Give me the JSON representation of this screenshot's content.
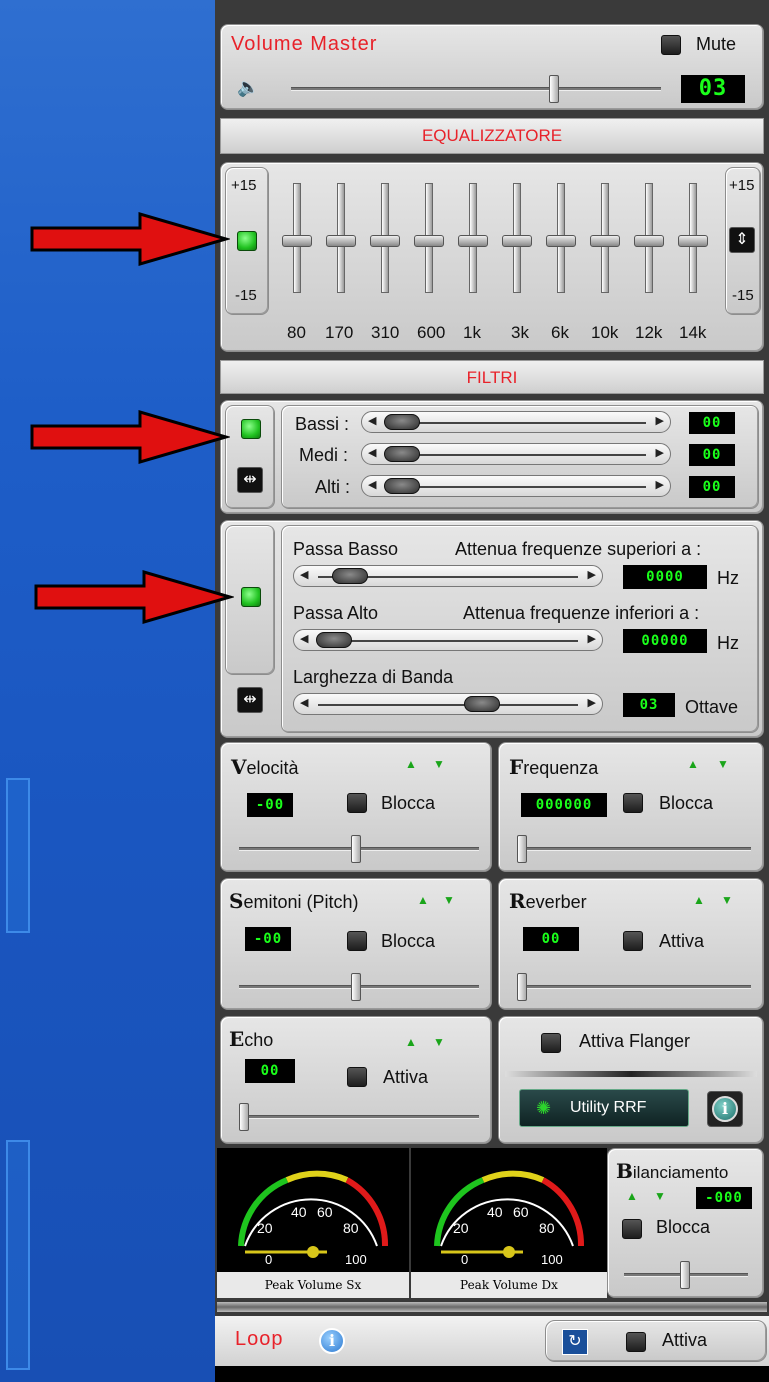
{
  "master": {
    "title": "Volume Master",
    "mute_label": "Mute",
    "volume_display": "03"
  },
  "equalizer": {
    "title": "EQUALIZZATORE",
    "top_label": "+15",
    "bottom_label": "-15",
    "bands": [
      "80",
      "170",
      "310",
      "600",
      "1k",
      "3k",
      "6k",
      "10k",
      "12k",
      "14k"
    ]
  },
  "filters": {
    "title": "FILTRI",
    "tone": [
      {
        "label": "Bassi :",
        "value": "00"
      },
      {
        "label": "Medi :",
        "value": "00"
      },
      {
        "label": "Alti :",
        "value": "00"
      }
    ],
    "low_pass": {
      "label": "Passa Basso",
      "desc": "Attenua frequenze superiori a :",
      "value": "0000",
      "unit": "Hz"
    },
    "high_pass": {
      "label": "Passa Alto",
      "desc": "Attenua frequenze inferiori a :",
      "value": "00000",
      "unit": "Hz"
    },
    "bandwidth": {
      "label": "Larghezza di Banda",
      "value": "03",
      "unit": "Ottave"
    }
  },
  "velocita": {
    "initial": "V",
    "rest": "elocità",
    "value": "-00",
    "lock_label": "Blocca"
  },
  "frequenza": {
    "initial": "F",
    "rest": "requenza",
    "value": "000000",
    "lock_label": "Blocca"
  },
  "semitoni": {
    "initial": "S",
    "rest": "emitoni (Pitch)",
    "value": "-00",
    "lock_label": "Blocca"
  },
  "reverber": {
    "initial": "R",
    "rest": "everber",
    "value": "00",
    "active_label": "Attiva"
  },
  "echo": {
    "initial": "E",
    "rest": "cho",
    "value": "00",
    "active_label": "Attiva"
  },
  "flanger": {
    "label": "Attiva Flanger",
    "utility_label": "Utility RRF"
  },
  "meters": [
    {
      "label": "Peak Volume Sx",
      "ticks": [
        "0",
        "20",
        "40",
        "60",
        "80",
        "100"
      ]
    },
    {
      "label": "Peak Volume Dx",
      "ticks": [
        "0",
        "20",
        "40",
        "60",
        "80",
        "100"
      ]
    }
  ],
  "bilanciamento": {
    "initial": "B",
    "rest": "ilanciamento",
    "value": "-000",
    "lock_label": "Blocca"
  },
  "loop": {
    "label": "Loop",
    "active_label": "Attiva"
  },
  "colors": {
    "accent_red": "#e8222a",
    "lcd_green": "#1aff1a",
    "led_green": "#21c221",
    "annotation_arrow": "#e01010"
  }
}
